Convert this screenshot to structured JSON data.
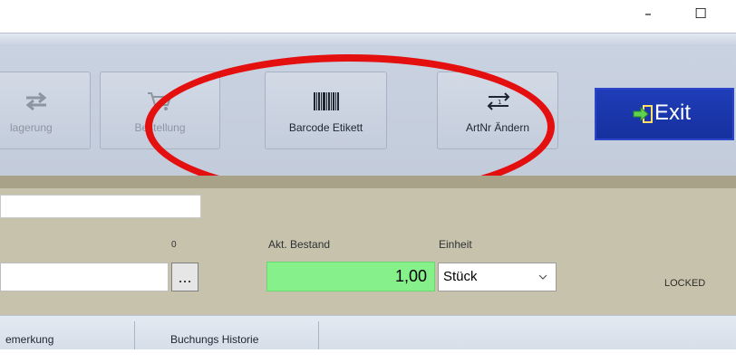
{
  "window": {
    "minimize": "–",
    "maximize": "☐"
  },
  "toolbar": {
    "buttons": [
      {
        "label": "lagerung",
        "icon": "transfer-icon",
        "enabled": false
      },
      {
        "label": "Bestellung",
        "icon": "cart-icon",
        "enabled": false
      },
      {
        "label": "Barcode Etikett",
        "icon": "barcode-icon",
        "enabled": true
      },
      {
        "label": "ArtNr Ändern",
        "icon": "swap-arrows-icon",
        "enabled": true
      }
    ],
    "exit_label": "Exit",
    "exit_icon": "exit-arrow-icon"
  },
  "form": {
    "count_label": "0",
    "bestand_label": "Akt. Bestand",
    "bestand_value": "1,00",
    "einheit_label": "Einheit",
    "einheit_value": "Stück",
    "ellipsis_label": "...",
    "status": "LOCKED"
  },
  "tabs": [
    {
      "label": "emerkung"
    },
    {
      "label": "Buchungs Historie"
    }
  ],
  "colors": {
    "highlight": "#e40f0f",
    "bestand_bg": "#86f08a",
    "exit_bg": "#1f3db8",
    "panel_bg": "#c7c2ab"
  }
}
